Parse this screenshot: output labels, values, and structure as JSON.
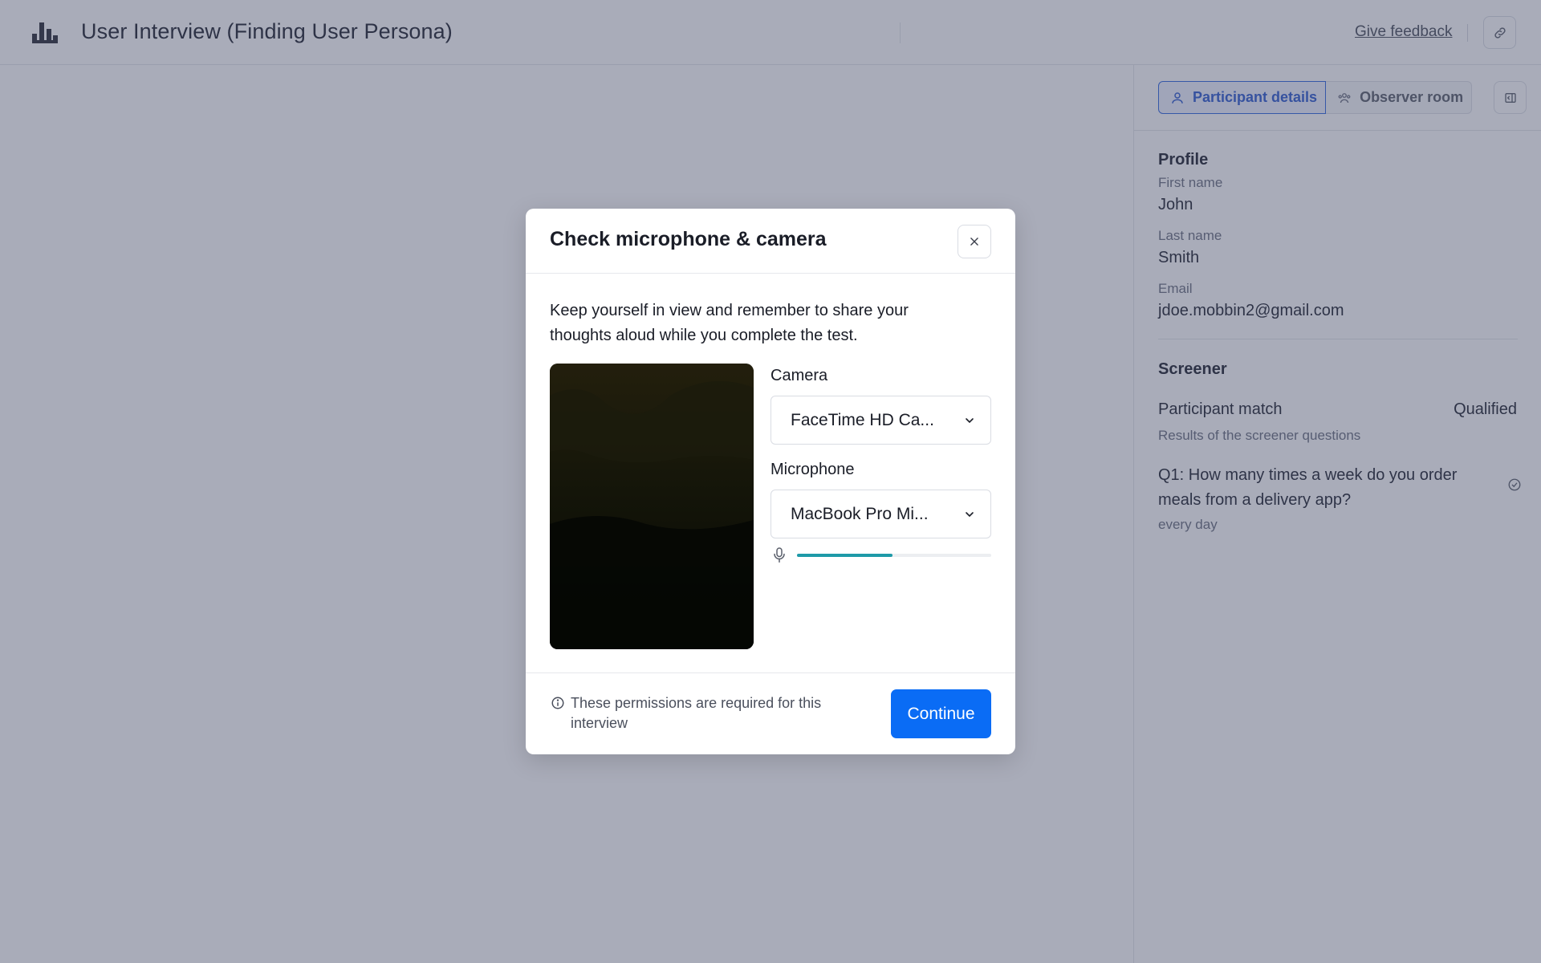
{
  "header": {
    "title": "User Interview (Finding User Persona)",
    "feedback_label": "Give feedback"
  },
  "side_panel": {
    "tabs": [
      {
        "label": "Participant details",
        "active": true
      },
      {
        "label": "Observer room",
        "active": false
      }
    ],
    "profile": {
      "title": "Profile",
      "first_name_label": "First name",
      "first_name": "John",
      "last_name_label": "Last name",
      "last_name": "Smith",
      "email_label": "Email",
      "email": "jdoe.mobbin2@gmail.com"
    },
    "screener": {
      "title": "Screener",
      "match_label": "Participant match",
      "match_value": "Qualified",
      "results_text": "Results of the screener questions",
      "question": "Q1: How many times a week do you order meals from a delivery app?",
      "answer": "every day"
    }
  },
  "modal": {
    "title": "Check microphone & camera",
    "description": "Keep yourself in view and remember to share your thoughts aloud while you complete the test.",
    "camera_label": "Camera",
    "camera_value": "FaceTime HD Ca...",
    "microphone_label": "Microphone",
    "microphone_value": "MacBook Pro Mi...",
    "mic_level": 0.49,
    "permission_text": "These permissions are required for this interview",
    "continue_label": "Continue"
  },
  "colors": {
    "accent": "#0a6cf5",
    "active_tab": "#2f5bd0",
    "mic_level": "#1e9aa8",
    "overlay": "#404664"
  },
  "icons": [
    "logo-icon",
    "link-icon",
    "person-icon",
    "observers-icon",
    "collapse-panel-icon",
    "check-circle-icon",
    "close-icon",
    "chevron-down-icon",
    "microphone-icon",
    "info-icon"
  ]
}
